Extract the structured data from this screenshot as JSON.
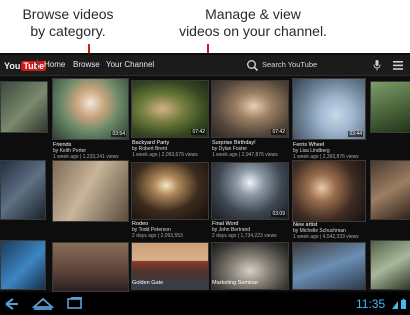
{
  "callouts": {
    "left": [
      "Browse videos",
      "by category."
    ],
    "right": [
      "Manage & view",
      "videos on your channel."
    ],
    "accent": "#d01818"
  },
  "appbar": {
    "logo": {
      "you": "You",
      "tube": "Tube"
    },
    "nav": [
      "Home",
      "Browse",
      "Your Channel"
    ],
    "search_placeholder": "Search YouTube",
    "icons": [
      "search-icon",
      "mic-icon",
      "menu-icon"
    ]
  },
  "videos": [
    {
      "duration": "",
      "title": "",
      "by": "",
      "stats": ""
    },
    {
      "duration": "03:54",
      "title": "Friends",
      "by": "by Keith Porter",
      "stats": "1 week ago | 1,233,241 views"
    },
    {
      "duration": "07:42",
      "title": "Backyard Party",
      "by": "by Robert Brent",
      "stats": "1 week ago | 2,093,679 views"
    },
    {
      "duration": "07:42",
      "title": "Surprise Birthday!",
      "by": "by Dylan Foster",
      "stats": "1 week ago | 2,947,876 views"
    },
    {
      "duration": "03:44",
      "title": "Ferris Wheel",
      "by": "by Lisa Lindberg",
      "stats": "1 week ago | 2,393,876 views"
    },
    {
      "duration": "",
      "title": "Rodeo",
      "by": "by Todd Peterson",
      "stats": "2 days ago | 2,093,553"
    },
    {
      "duration": "03:09",
      "title": "Final Word",
      "by": "by John Bertrand",
      "stats": "2 days ago | 1,734,223 views"
    },
    {
      "duration": "",
      "title": "New artist",
      "by": "by Michelle Schuchman",
      "stats": "1 week ago | 4,542,333 views"
    },
    {
      "duration": "",
      "title": "Golden Gate",
      "by": "",
      "stats": ""
    },
    {
      "duration": "",
      "title": "Marketing Seminar",
      "by": "",
      "stats": ""
    },
    {
      "duration": "",
      "title": "",
      "by": "",
      "stats": ""
    },
    {
      "duration": "",
      "title": "",
      "by": "",
      "stats": ""
    }
  ],
  "status": {
    "time": "11:35"
  }
}
